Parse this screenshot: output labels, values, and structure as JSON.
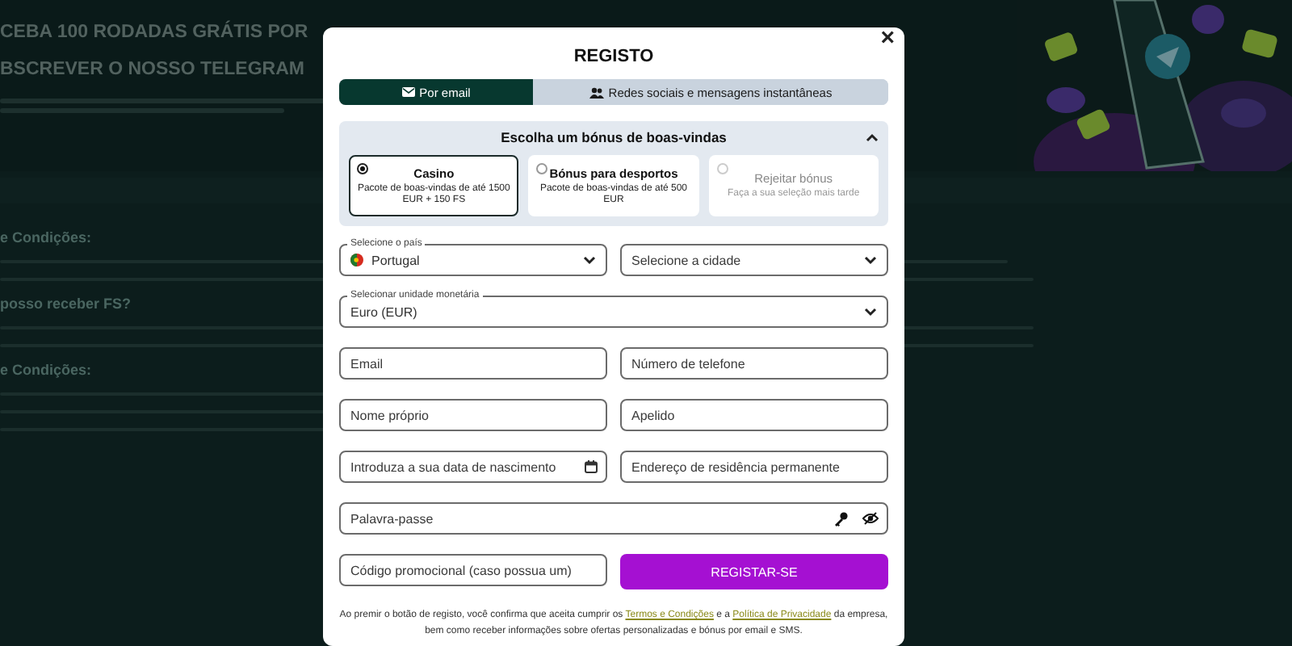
{
  "background": {
    "headline": [
      "CEBA 100 RODADAS GRÁTIS POR",
      "BSCREVER O NOSSO TELEGRAM"
    ],
    "sections": [
      "e Condições:",
      "posso receber FS?",
      "e Condições:"
    ],
    "banner": {
      "kind": "picture"
    }
  },
  "modal": {
    "title": "REGISTO",
    "close": "×",
    "tabs": [
      {
        "label": "Por email",
        "selected": true
      },
      {
        "label": "Redes sociais e mensagens instantâneas",
        "selected": false
      }
    ],
    "bonus": {
      "title": "Escolha um bónus de boas-vindas",
      "expanded": true,
      "options": [
        {
          "title": "Casino",
          "description": "Pacote de boas-vindas de até 1500 EUR + 150 FS",
          "selected": true,
          "disabled": false
        },
        {
          "title": "Bónus para desportos",
          "description": "Pacote de boas-vindas de até 500 EUR",
          "selected": false,
          "disabled": false
        },
        {
          "title": "Rejeitar bónus",
          "description": "Faça a sua seleção mais tarde",
          "selected": false,
          "disabled": true
        }
      ]
    },
    "rows": [
      [
        {
          "kind": "country",
          "label": "Selecione o país",
          "value": "Portugal"
        },
        {
          "kind": "select",
          "placeholder": "Selecione a cidade"
        }
      ],
      [
        {
          "kind": "select",
          "label": "Selecionar unidade monetária",
          "value": "Euro (EUR)"
        }
      ],
      [
        {
          "kind": "input",
          "placeholder": "Email"
        },
        {
          "kind": "input",
          "placeholder": "Número de telefone"
        }
      ],
      [
        {
          "kind": "input",
          "placeholder": "Nome próprio"
        },
        {
          "kind": "input",
          "placeholder": "Apelido"
        }
      ],
      [
        {
          "kind": "date",
          "placeholder": "Introduza a sua data de nascimento"
        },
        {
          "kind": "input",
          "placeholder": "Endereço de residência permanente"
        }
      ],
      [
        {
          "kind": "password",
          "placeholder": "Palavra-passe"
        }
      ],
      [
        {
          "kind": "input",
          "placeholder": "Código promocional (caso possua um)"
        },
        {
          "kind": "button",
          "label": "REGISTAR-SE"
        }
      ]
    ],
    "consent": [
      {
        "kind": "text",
        "text": "Ao premir o botão de registo, você confirma que aceita cumprir os "
      },
      {
        "kind": "link",
        "text": "Termos e Condições"
      },
      {
        "kind": "text",
        "text": " e a "
      },
      {
        "kind": "link",
        "text": "Política de Privacidade"
      },
      {
        "kind": "text",
        "text": " da empresa, bem como receber informações sobre ofertas personalizadas e bónus por email e SMS."
      }
    ]
  }
}
